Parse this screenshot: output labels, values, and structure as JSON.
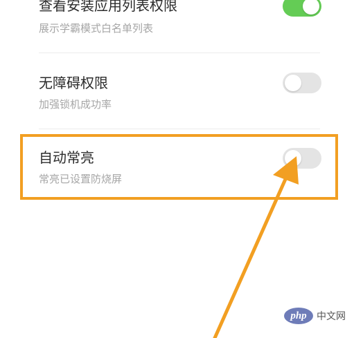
{
  "settings": [
    {
      "title": "查看安装应用列表权限",
      "description": "展示学霸模式白名单列表",
      "enabled": true
    },
    {
      "title": "无障碍权限",
      "description": "加强锁机成功率",
      "enabled": false
    },
    {
      "title": "自动常亮",
      "description": "常亮已设置防烧屏",
      "enabled": false
    }
  ],
  "annotation": {
    "color": "#f29f22"
  },
  "watermark": {
    "logo_text": "php",
    "site_text": "中文网"
  },
  "colors": {
    "toggle_on": "#64cc55",
    "toggle_off": "#e4e4e4"
  }
}
